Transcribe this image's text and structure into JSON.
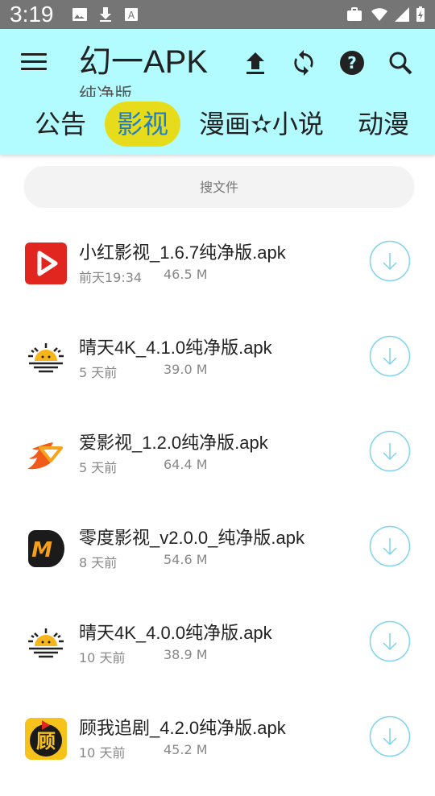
{
  "status_bar": {
    "time": "3:19",
    "left_icons": [
      "image-icon",
      "download-icon",
      "text-a-icon"
    ],
    "right_icons": [
      "briefcase-icon",
      "wifi-icon",
      "signal-icon",
      "battery-charging-icon"
    ]
  },
  "app_bar": {
    "title": "幻一APK",
    "subtitle": "纯净版",
    "actions": [
      "upload-icon",
      "sync-icon",
      "help-icon",
      "search-icon"
    ],
    "background": "#b2fbff"
  },
  "tabs": [
    {
      "label": "公告",
      "active": false
    },
    {
      "label": "影视",
      "active": true
    },
    {
      "label": "漫画✫小说",
      "active": false
    },
    {
      "label": "动漫",
      "active": false
    }
  ],
  "search": {
    "placeholder": "搜文件"
  },
  "files": [
    {
      "name": "小红影视_1.6.7纯净版.apk",
      "date": "前天19:34",
      "size": "46.5 M",
      "icon": "red-play-app-icon"
    },
    {
      "name": "晴天4K_4.1.0纯净版.apk",
      "date": "5 天前",
      "size": "39.0 M",
      "icon": "sunrise-app-icon"
    },
    {
      "name": "爱影视_1.2.0纯净版.apk",
      "date": "5 天前",
      "size": "64.4 M",
      "icon": "flame-app-icon"
    },
    {
      "name": "零度影视_v2.0.0_纯净版.apk",
      "date": "8 天前",
      "size": "54.6 M",
      "icon": "m-logo-app-icon"
    },
    {
      "name": "晴天4K_4.0.0纯净版.apk",
      "date": "10 天前",
      "size": "38.9 M",
      "icon": "sunrise-app-icon"
    },
    {
      "name": "顾我追剧_4.2.0纯净版.apk",
      "date": "10 天前",
      "size": "45.2 M",
      "icon": "gu-app-icon"
    }
  ],
  "colors": {
    "accent": "#1e7ec8",
    "active_tab_bg": "#e6dc1c",
    "download_button": "#7fd3ec"
  }
}
